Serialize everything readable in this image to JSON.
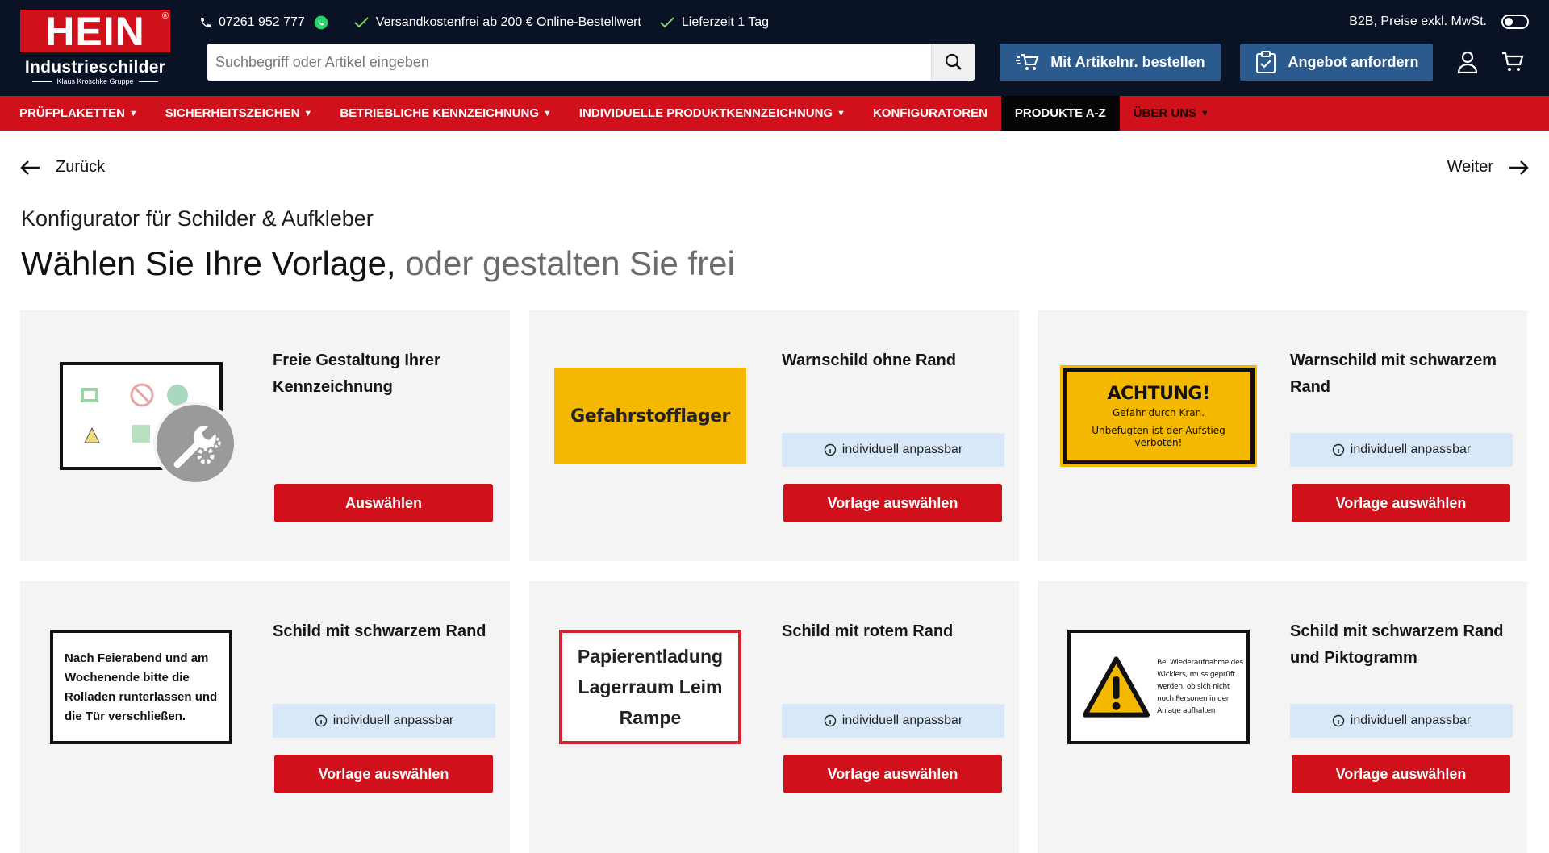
{
  "header": {
    "logo": {
      "brand": "HEIN",
      "registered": "®",
      "line1": "Industrieschilder",
      "line2": "Klaus Kroschke Gruppe"
    },
    "phone": "07261 952 777",
    "shipping_note": "Versandkostenfrei ab 200 € Online-Bestellwert",
    "delivery_note": "Lieferzeit 1 Tag",
    "b2b_label": "B2B, Preise exkl. MwSt.",
    "search_placeholder": "Suchbegriff oder Artikel eingeben",
    "order_button": "Mit Artikelnr. bestellen",
    "offer_button": "Angebot anfordern"
  },
  "nav": {
    "items": [
      {
        "label": "PRÜFPLAKETTEN"
      },
      {
        "label": "SICHERHEITSZEICHEN"
      },
      {
        "label": "BETRIEBLICHE KENNZEICHNUNG"
      },
      {
        "label": "INDIVIDUELLE PRODUKTKENNZEICHNUNG"
      },
      {
        "label": "KONFIGURATOREN"
      },
      {
        "label": "PRODUKTE A-Z"
      },
      {
        "label": "ÜBER UNS"
      }
    ]
  },
  "pager": {
    "back": "Zurück",
    "next": "Weiter"
  },
  "page": {
    "subtitle": "Konfigurator für Schilder & Aufkleber",
    "title_main": "Wählen Sie Ihre Vorlage,",
    "title_muted": "oder gestalten Sie frei"
  },
  "cards": [
    {
      "title": "Freie Gestaltung Ihrer Kennzeichnung",
      "button": "Auswählen"
    },
    {
      "title": "Warnschild ohne Rand",
      "badge": "individuell anpassbar",
      "button": "Vorlage auswählen"
    },
    {
      "title": "Warnschild mit schwarzem Rand",
      "badge": "individuell anpassbar",
      "button": "Vorlage auswählen"
    },
    {
      "title": "Schild mit schwarzem Rand",
      "badge": "individuell anpassbar",
      "button": "Vorlage auswählen"
    },
    {
      "title": "Schild mit rotem Rand",
      "badge": "individuell anpassbar",
      "button": "Vorlage auswählen"
    },
    {
      "title": "Schild mit schwarzem Rand und Piktogramm",
      "badge": "individuell anpassbar",
      "button": "Vorlage auswählen"
    }
  ],
  "signs": {
    "yellow_text": "Gefahrstofflager",
    "achtung_title": "ACHTUNG!",
    "achtung_line1": "Gefahr durch Kran.",
    "achtung_line2": "Unbefugten ist der Aufstieg verboten!",
    "black_text": "Nach Feierabend und am Wochenende bitte die Rolladen runterlassen und die Tür verschließen.",
    "red_text": "Papierentladung Lagerraum Leim Rampe",
    "picto_text": "Bei Wiederaufnahme des Wicklers, muss geprüft werden, ob sich nicht noch Personen in der Anlage aufhalten"
  },
  "colors": {
    "brand_red": "#d0101a",
    "header_navy": "#0a1226",
    "button_blue": "#2a5a8e",
    "badge_blue": "#d9e8f8",
    "sign_yellow": "#f5b800"
  },
  "icons": [
    "phone-icon",
    "whatsapp-icon",
    "check-icon",
    "search-icon",
    "cart-plus-icon",
    "clipboard-icon",
    "user-icon",
    "cart-icon",
    "arrow-left-icon",
    "arrow-right-icon",
    "info-icon",
    "wrench-gear-icon",
    "warning-triangle-icon"
  ]
}
